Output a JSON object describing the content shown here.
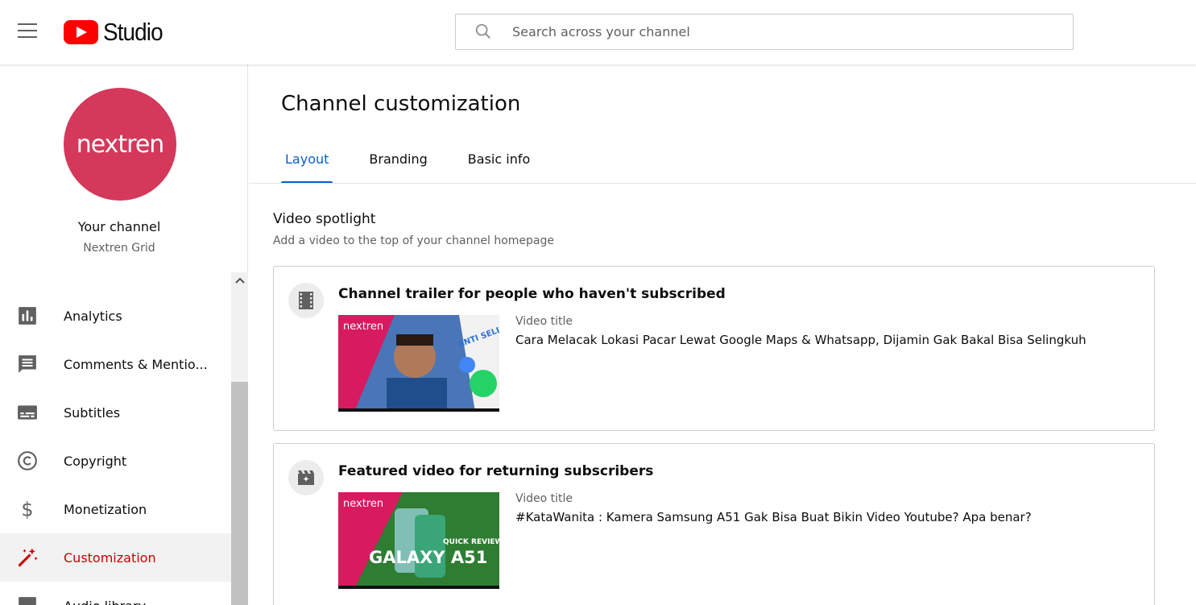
{
  "header": {
    "logo_text": "Studio",
    "search_placeholder": "Search across your channel"
  },
  "sidebar": {
    "avatar_text": "nextren",
    "your_channel": "Your channel",
    "channel_name": "Nextren Grid",
    "items": [
      {
        "label": "Analytics",
        "icon": "analytics-icon"
      },
      {
        "label": "Comments & Mentio...",
        "icon": "comments-icon"
      },
      {
        "label": "Subtitles",
        "icon": "subtitles-icon"
      },
      {
        "label": "Copyright",
        "icon": "copyright-icon"
      },
      {
        "label": "Monetization",
        "icon": "dollar-icon"
      },
      {
        "label": "Customization",
        "icon": "magic-wand-icon",
        "active": true
      },
      {
        "label": "Audio library",
        "icon": "audio-library-icon"
      }
    ]
  },
  "main": {
    "page_title": "Channel customization",
    "tabs": [
      {
        "label": "Layout",
        "active": true
      },
      {
        "label": "Branding"
      },
      {
        "label": "Basic info"
      }
    ],
    "section": {
      "title": "Video spotlight",
      "subtitle": "Add a video to the top of your channel homepage"
    },
    "cards": [
      {
        "title": "Channel trailer for people who haven't subscribed",
        "field_label": "Video title",
        "field_value": "Cara Melacak Lokasi Pacar Lewat Google Maps & Whatsapp, Dijamin Gak Bakal Bisa Selingkuh",
        "thumb_brand": "nextren",
        "thumb_caption": "ANTI SELINGKUH!"
      },
      {
        "title": "Featured video for returning subscribers",
        "field_label": "Video title",
        "field_value": "#KataWanita : Kamera Samsung A51 Gak Bisa Buat Bikin Video Youtube? Apa benar?",
        "thumb_brand": "nextren",
        "thumb_caption": "GALAXY A51",
        "thumb_tag": "QUICK REVIEW"
      }
    ]
  },
  "colors": {
    "accent": "#065fd4",
    "active_nav": "#cc0000",
    "brand_red": "#ff0000",
    "avatar": "#d4385a"
  }
}
